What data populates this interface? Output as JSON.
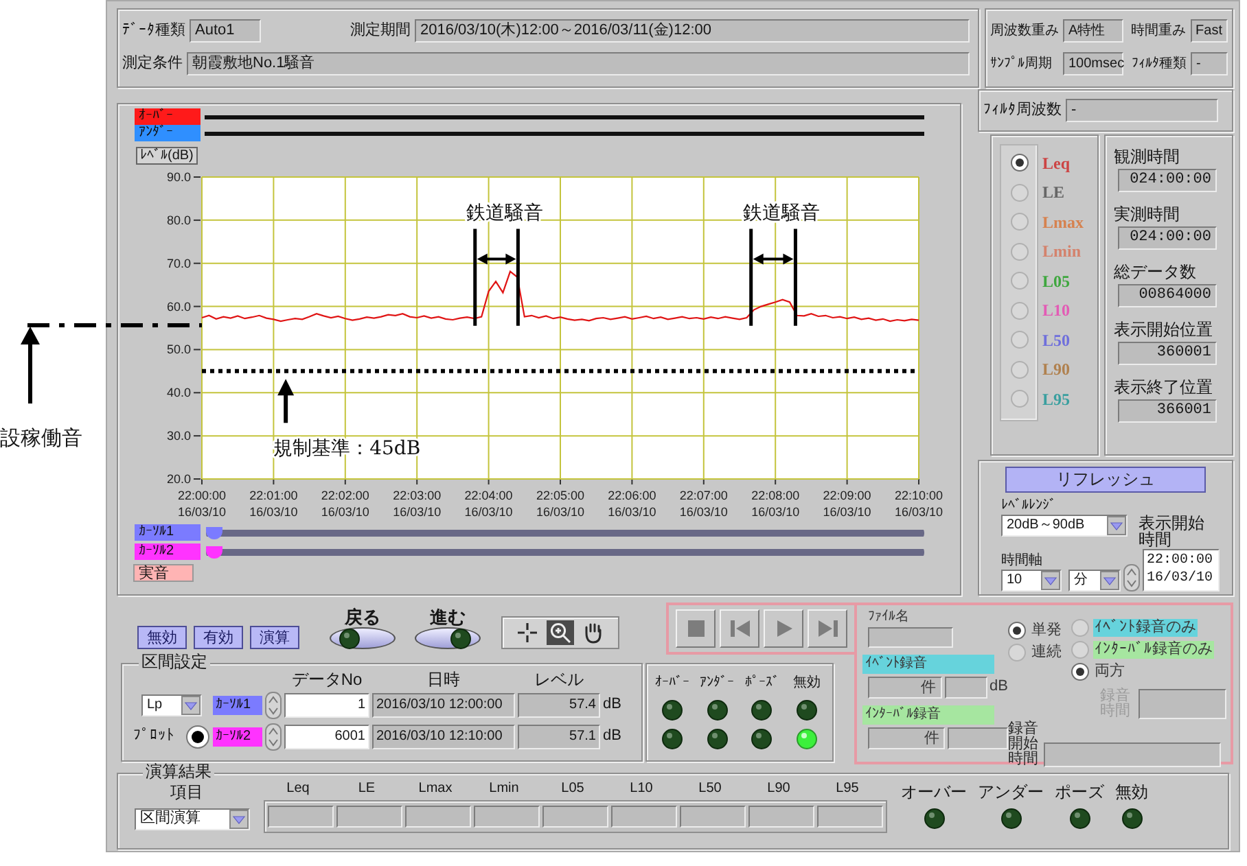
{
  "measurement": {
    "rows": [
      [
        {
          "label": "ﾃﾞｰﾀ種類",
          "value": "Auto1"
        },
        {
          "label": "測定期間",
          "value": "2016/03/10(木)12:00～2016/03/11(金)12:00"
        }
      ],
      [
        {
          "label": "測定条件",
          "value": "朝霞敷地No.1騒音"
        }
      ]
    ]
  },
  "settings": {
    "rows": [
      [
        {
          "label": "周波数重み",
          "value": "A特性"
        },
        {
          "label": "時間重み",
          "value": "Fast"
        }
      ],
      [
        {
          "label": "ｻﾝﾌﾟﾙ周期",
          "value": "100msec"
        },
        {
          "label": "ﾌｨﾙﾀ種類",
          "value": "-"
        }
      ]
    ],
    "filter_frequency": {
      "label": "ﾌｨﾙﾀ周波数",
      "value": "-"
    }
  },
  "chart": {
    "limit_bars": [
      {
        "label": "ｵｰﾊﾞｰ",
        "color": "#ff1a1a"
      },
      {
        "label": "ｱﾝﾀﾞｰ",
        "color": "#2f8fff"
      }
    ],
    "chart_data": {
      "type": "line",
      "ylabel": "ﾚﾍﾞﾙ(dB)",
      "ylim": [
        20,
        90
      ],
      "grid": true,
      "yticks": [
        {
          "value": 90,
          "label": "90.0"
        },
        {
          "value": 80,
          "label": "80.0"
        },
        {
          "value": 70,
          "label": "70.0"
        },
        {
          "value": 60,
          "label": "60.0"
        },
        {
          "value": 50,
          "label": "50.0"
        },
        {
          "value": 40,
          "label": "40.0"
        },
        {
          "value": 30,
          "label": "30.0"
        },
        {
          "value": 20,
          "label": "20.0"
        }
      ],
      "categories": [
        "22:00:00\n16/03/10",
        null,
        null,
        null,
        null,
        null,
        null,
        null,
        null,
        null,
        "22:01:00\n16/03/10",
        null,
        null,
        null,
        null,
        null,
        null,
        null,
        null,
        null,
        "22:02:00\n16/03/10",
        null,
        null,
        null,
        null,
        null,
        null,
        null,
        null,
        null,
        "22:03:00\n16/03/10",
        null,
        null,
        null,
        null,
        null,
        null,
        null,
        null,
        null,
        "22:04:00\n16/03/10",
        null,
        null,
        null,
        null,
        null,
        null,
        null,
        null,
        null,
        "22:05:00\n16/03/10",
        null,
        null,
        null,
        null,
        null,
        null,
        null,
        null,
        null,
        "22:06:00\n16/03/10",
        null,
        null,
        null,
        null,
        null,
        null,
        null,
        null,
        null,
        "22:07:00\n16/03/10",
        null,
        null,
        null,
        null,
        null,
        null,
        null,
        null,
        null,
        "22:08:00\n16/03/10",
        null,
        null,
        null,
        null,
        null,
        null,
        null,
        null,
        null,
        "22:09:00\n16/03/10",
        null,
        null,
        null,
        null,
        null,
        null,
        null,
        null,
        null,
        "22:10:00\n16/03/10"
      ],
      "values": [
        57.4,
        57.9,
        57.1,
        57.6,
        57.3,
        57.8,
        57.2,
        57.5,
        57.9,
        57.3,
        57.0,
        56.6,
        56.9,
        57.2,
        57.0,
        57.6,
        58.3,
        57.8,
        57.4,
        57.7,
        57.2,
        56.8,
        57.1,
        57.5,
        57.3,
        57.6,
        58.1,
        57.9,
        58.3,
        57.6,
        57.4,
        57.8,
        57.3,
        57.6,
        57.1,
        56.9,
        57.3,
        57.5,
        57.2,
        57.6,
        63.5,
        65.8,
        63.2,
        68.1,
        66.8,
        57.6,
        57.9,
        57.4,
        57.8,
        57.2,
        57.5,
        57.1,
        56.8,
        57.0,
        56.7,
        57.2,
        57.4,
        57.0,
        57.3,
        57.6,
        57.1,
        57.4,
        57.7,
        57.2,
        57.5,
        57.0,
        57.3,
        57.6,
        57.2,
        57.4,
        57.1,
        57.5,
        57.2,
        57.6,
        57.3,
        57.0,
        57.4,
        59.2,
        60.0,
        60.5,
        61.0,
        61.6,
        61.0,
        57.9,
        57.8,
        58.3,
        57.7,
        57.9,
        57.4,
        57.6,
        57.2,
        57.5,
        57.0,
        57.3,
        56.8,
        57.1,
        56.6,
        56.9,
        56.7,
        57.0,
        56.8
      ],
      "ref_lines": [
        {
          "axis": "y",
          "value": 45,
          "label": "規制基準：45dB"
        }
      ]
    },
    "notes": {
      "intervals": [
        {
          "label": "鉄道騒音"
        },
        {
          "label": "鉄道騒音"
        }
      ],
      "baseline_label": "設稼働音"
    },
    "cursors": [
      {
        "label": "ｶｰｿﾙ1",
        "color": "#7b7bff",
        "level": 0
      },
      {
        "label": "ｶｰｿﾙ2",
        "color": "#ff33ff",
        "level": 0
      }
    ],
    "audio_label": "実音"
  },
  "metrics": [
    {
      "label": "Leq",
      "color": "#cc4444",
      "selected": true
    },
    {
      "label": "LE",
      "color": "#666666",
      "selected": false
    },
    {
      "label": "Lmax",
      "color": "#d6824f",
      "selected": false
    },
    {
      "label": "Lmin",
      "color": "#d4826c",
      "selected": false
    },
    {
      "label": "L05",
      "color": "#3fa73f",
      "selected": false
    },
    {
      "label": "L10",
      "color": "#e35bb5",
      "selected": false
    },
    {
      "label": "L50",
      "color": "#6f6fdc",
      "selected": false
    },
    {
      "label": "L90",
      "color": "#b0814f",
      "selected": false
    },
    {
      "label": "L95",
      "color": "#3a9f9f",
      "selected": false
    }
  ],
  "info": [
    {
      "label": "観測時間",
      "value": "024:00:00"
    },
    {
      "label": "実測時間",
      "value": "024:00:00"
    },
    {
      "label": "総データ数",
      "value": "00864000"
    },
    {
      "label": "表示開始位置",
      "value": "360001"
    },
    {
      "label": "表示終了位置",
      "value": "366001"
    }
  ],
  "display": {
    "refresh": "リフレッシュ",
    "level_range": {
      "label": "ﾚﾍﾞﾙﾚﾝｼﾞ",
      "value": "20dB～90dB"
    },
    "start_time": {
      "label": "表示開始時間",
      "lines": [
        "22:00:00",
        "16/03/10"
      ]
    },
    "time_axis": {
      "label": "時間軸",
      "value": "10",
      "unit": "分"
    }
  },
  "mode_buttons": [
    "無効",
    "有効",
    "演算"
  ],
  "nav_buttons": [
    {
      "label": "戻る",
      "kind": "back"
    },
    {
      "label": "進む",
      "kind": "forward"
    }
  ],
  "tools": [
    {
      "kind": "crosshair",
      "selected": false
    },
    {
      "kind": "zoom",
      "selected": true
    },
    {
      "kind": "pan",
      "selected": false
    }
  ],
  "transport": [
    {
      "kind": "stop"
    },
    {
      "kind": "first"
    },
    {
      "kind": "play"
    },
    {
      "kind": "last"
    }
  ],
  "section": {
    "title": "区間設定",
    "columns": [
      "データNo",
      "日時",
      "レベル"
    ],
    "statistic": "Lp",
    "plot": {
      "label": "ﾌﾟﾛｯﾄ",
      "on": true
    },
    "cursors": [
      {
        "label": "ｶｰｿﾙ1",
        "color": "#7b7bff",
        "data_no": "1",
        "datetime": "2016/03/10 12:00:00",
        "reading": "57.4",
        "unit": "dB"
      },
      {
        "label": "ｶｰｿﾙ2",
        "color": "#ff33ff",
        "data_no": "6001",
        "datetime": "2016/03/10 12:10:00",
        "reading": "57.1",
        "unit": "dB"
      }
    ]
  },
  "status": {
    "labels": [
      "ｵｰﾊﾞｰ",
      "ｱﾝﾀﾞｰ",
      "ﾎﾟｰｽﾞ",
      "無効"
    ],
    "rows": [
      [
        {
          "on": false
        },
        {
          "on": false
        },
        {
          "on": false
        },
        {
          "on": false
        }
      ],
      [
        {
          "on": false
        },
        {
          "on": false
        },
        {
          "on": false
        },
        {
          "on": true
        }
      ]
    ]
  },
  "recording": {
    "file_name": {
      "label": "ﾌｧｲﾙ名"
    },
    "mode": [
      {
        "label": "単発",
        "selected": true
      },
      {
        "label": "連続",
        "selected": false
      }
    ],
    "target": [
      {
        "label": "ｲﾍﾞﾝﾄ録音のみ",
        "color": "#66d3dc",
        "selected": false
      },
      {
        "label": "ｲﾝﾀｰﾊﾞﾙ録音のみ",
        "color": "#a6e6a0",
        "selected": false
      },
      {
        "label": "両方",
        "selected": true
      }
    ],
    "event": {
      "label": "ｲﾍﾞﾝﾄ録音",
      "color": "#66d3dc",
      "count_unit": "件",
      "level_unit": "dB"
    },
    "interval": {
      "label": "ｲﾝﾀｰﾊﾞﾙ録音",
      "color": "#a6e6a0",
      "count_unit": "件"
    },
    "duration": {
      "label": "録音時間",
      "disabled": true
    },
    "start_time": {
      "label": "録音開始時間",
      "disabled": false
    }
  },
  "results": {
    "title": "演算結果",
    "item_label": "項目",
    "item_value": "区間演算",
    "columns": [
      "Leq",
      "LE",
      "Lmax",
      "Lmin",
      "L05",
      "L10",
      "L50",
      "L90",
      "L95"
    ],
    "indicators": [
      {
        "label": "オーバー",
        "on": false
      },
      {
        "label": "アンダー",
        "on": false
      },
      {
        "label": "ポーズ",
        "on": false
      },
      {
        "label": "無効",
        "on": false
      }
    ]
  }
}
